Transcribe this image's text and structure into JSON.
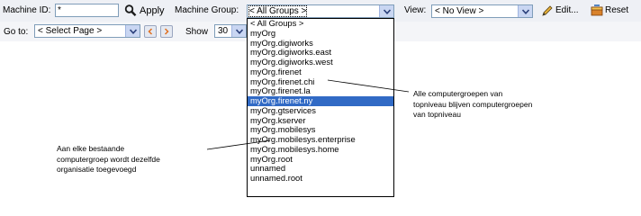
{
  "toolbar": {
    "machine_id_label": "Machine ID:",
    "machine_id_value": "*",
    "apply_label": "Apply",
    "machine_group_label": "Machine Group:",
    "machine_group_value": "< All Groups >",
    "view_label": "View:",
    "view_value": "< No View >",
    "edit_label": "Edit...",
    "reset_label": "Reset"
  },
  "pager": {
    "goto_label": "Go to:",
    "goto_value": "< Select Page >",
    "show_label": "Show",
    "show_value": "30"
  },
  "machine_group_dropdown": {
    "options": [
      "< All Groups >",
      "myOrg",
      "myOrg.digiworks",
      "myOrg.digiworks.east",
      "myOrg.digiworks.west",
      "myOrg.firenet",
      "myOrg.firenet.chi",
      "myOrg.firenet.la",
      "myOrg.firenet.ny",
      "myOrg.gtservices",
      "myOrg.kserver",
      "myOrg.mobilesys",
      "myOrg.mobilesys.enterprise",
      "myOrg.mobilesys.home",
      "myOrg.root",
      "unnamed",
      "unnamed.root"
    ],
    "selected_index": 8
  },
  "annotations": {
    "right": [
      "Alle computergroepen van",
      "topniveau blijven computergroepen",
      "van topniveau"
    ],
    "left": [
      "Aan elke bestaande",
      "computergroep wordt dezelfde",
      "organisatie toegevoegd"
    ]
  },
  "colors": {
    "selection": "#316ac5",
    "toolbar_bg": "#eef0f5",
    "input_border": "#7f9db9"
  },
  "icons": {
    "apply": "magnifier-icon",
    "edit": "pencil-icon",
    "reset": "reset-icon",
    "prev": "prev-page-icon",
    "next": "next-page-icon"
  }
}
